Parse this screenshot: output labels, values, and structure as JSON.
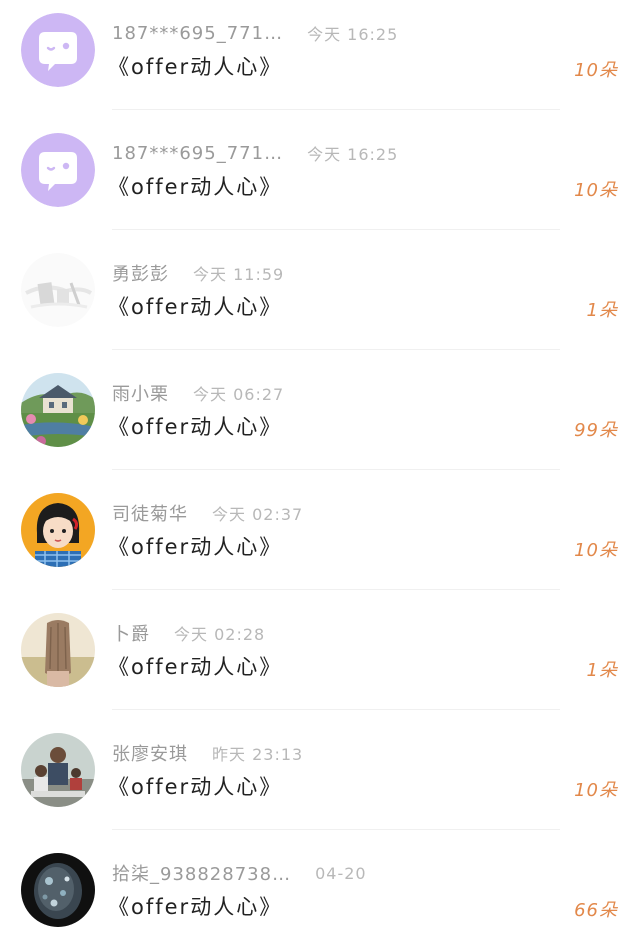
{
  "gifts": [
    {
      "name": "187***695_771…",
      "time": "今天 16:25",
      "gift": "《offer动人心》",
      "count": "10朵",
      "avatar_icon": "chat-bubble-wink-icon"
    },
    {
      "name": "187***695_771…",
      "time": "今天 16:25",
      "gift": "《offer动人心》",
      "count": "10朵",
      "avatar_icon": "chat-bubble-wink-icon"
    },
    {
      "name": "勇彭彭",
      "time": "今天 11:59",
      "gift": "《offer动人心》",
      "count": "1朵",
      "avatar_icon": "pale-sketch-avatar"
    },
    {
      "name": "雨小栗",
      "time": "今天 06:27",
      "gift": "《offer动人心》",
      "count": "99朵",
      "avatar_icon": "cottage-landscape-avatar"
    },
    {
      "name": "司徒菊华",
      "time": "今天 02:37",
      "gift": "《offer动人心》",
      "count": "10朵",
      "avatar_icon": "cartoon-girl-avatar"
    },
    {
      "name": "卜爵",
      "time": "今天 02:28",
      "gift": "《offer动人心》",
      "count": "1朵",
      "avatar_icon": "long-hair-back-avatar"
    },
    {
      "name": "张廖安琪",
      "time": "昨天 23:13",
      "gift": "《offer动人心》",
      "count": "10朵",
      "avatar_icon": "family-photo-avatar"
    },
    {
      "name": "拾柒_938828738…",
      "time": "04-20",
      "gift": "《offer动人心》",
      "count": "66朵",
      "avatar_icon": "dark-crystal-avatar"
    }
  ],
  "colors": {
    "name": "#9a9a9a",
    "time": "#b8b8b8",
    "title": "#222222",
    "count": "#e2884a",
    "bubble_avatar": "#cdb7f4"
  }
}
